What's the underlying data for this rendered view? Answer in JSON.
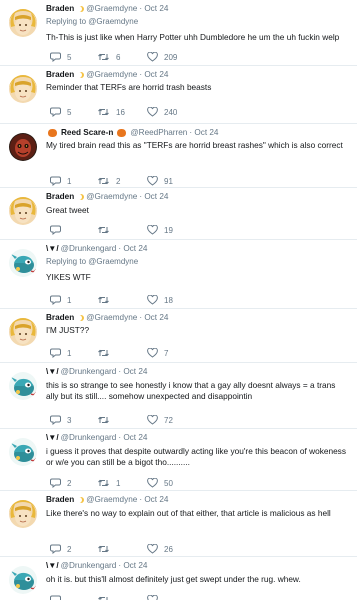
{
  "tweets": [
    {
      "name": "Braden",
      "badge": "moon",
      "handle": "@Graemdyne",
      "time": "· Oct 24",
      "replying": "Replying to @Graemdyne",
      "text": "Th-This is just like when Harry Potter uhh Dumbledore he um the uh fuckin welp",
      "replies": "5",
      "retweets": "6",
      "likes": "209",
      "avatar": "braden"
    },
    {
      "name": "Braden",
      "badge": "moon",
      "handle": "@Graemdyne",
      "time": "· Oct 24",
      "replying": "",
      "text": "Reminder that TERFs are horrid trash beasts",
      "replies": "5",
      "retweets": "16",
      "likes": "240",
      "avatar": "braden"
    },
    {
      "name": "Reed Scare-n",
      "badge": "pumpkin",
      "handle": "@ReedPharren",
      "time": "· Oct 24",
      "replying": "",
      "text": "My tired brain read this as \"TERFs are horrid breast rashes\" which is also correct",
      "replies": "1",
      "retweets": "2",
      "likes": "91",
      "avatar": "reed"
    },
    {
      "name": "Braden",
      "badge": "moon",
      "handle": "@Graemdyne",
      "time": "· Oct 24",
      "replying": "",
      "text": "Great tweet",
      "replies": "",
      "retweets": "",
      "likes": "19",
      "avatar": "braden"
    },
    {
      "name": "\\▼/",
      "badge": "",
      "handle": "@Drunkengard",
      "time": "· Oct 24",
      "replying": "Replying to @Graemdyne",
      "text": "YIKES WTF",
      "replies": "1",
      "retweets": "",
      "likes": "18",
      "avatar": "drunk"
    },
    {
      "name": "Braden",
      "badge": "moon",
      "handle": "@Graemdyne",
      "time": "· Oct 24",
      "replying": "",
      "text": "I'M JUST??",
      "replies": "1",
      "retweets": "",
      "likes": "7",
      "avatar": "braden"
    },
    {
      "name": "\\▼/",
      "badge": "",
      "handle": "@Drunkengard",
      "time": "· Oct 24",
      "replying": "",
      "text": "this is so strange to see honestly i know that a gay ally doesnt always = a trans ally but its still.... somehow unexpected and disappointin",
      "replies": "3",
      "retweets": "",
      "likes": "72",
      "avatar": "drunk"
    },
    {
      "name": "\\▼/",
      "badge": "",
      "handle": "@Drunkengard",
      "time": "· Oct 24",
      "replying": "",
      "text": "i guess it proves that despite outwardly acting like you're this beacon of wokeness or w/e you can still be a bigot tho..........",
      "replies": "2",
      "retweets": "1",
      "likes": "50",
      "avatar": "drunk"
    },
    {
      "name": "Braden",
      "badge": "moon",
      "handle": "@Graemdyne",
      "time": "· Oct 24",
      "replying": "",
      "text": "Like there's no way to explain out of that either, that article is malicious as hell",
      "replies": "2",
      "retweets": "",
      "likes": "26",
      "avatar": "braden"
    },
    {
      "name": "\\▼/",
      "badge": "",
      "handle": "@Drunkengard",
      "time": "· Oct 24",
      "replying": "",
      "text": "oh it is. but this'll almost definitely just get swept under the rug. whew.",
      "replies": "",
      "retweets": "",
      "likes": "",
      "avatar": "drunk"
    }
  ],
  "colors": {
    "text": "#14171a",
    "muted": "#657786",
    "divider": "#e6ecf0"
  }
}
